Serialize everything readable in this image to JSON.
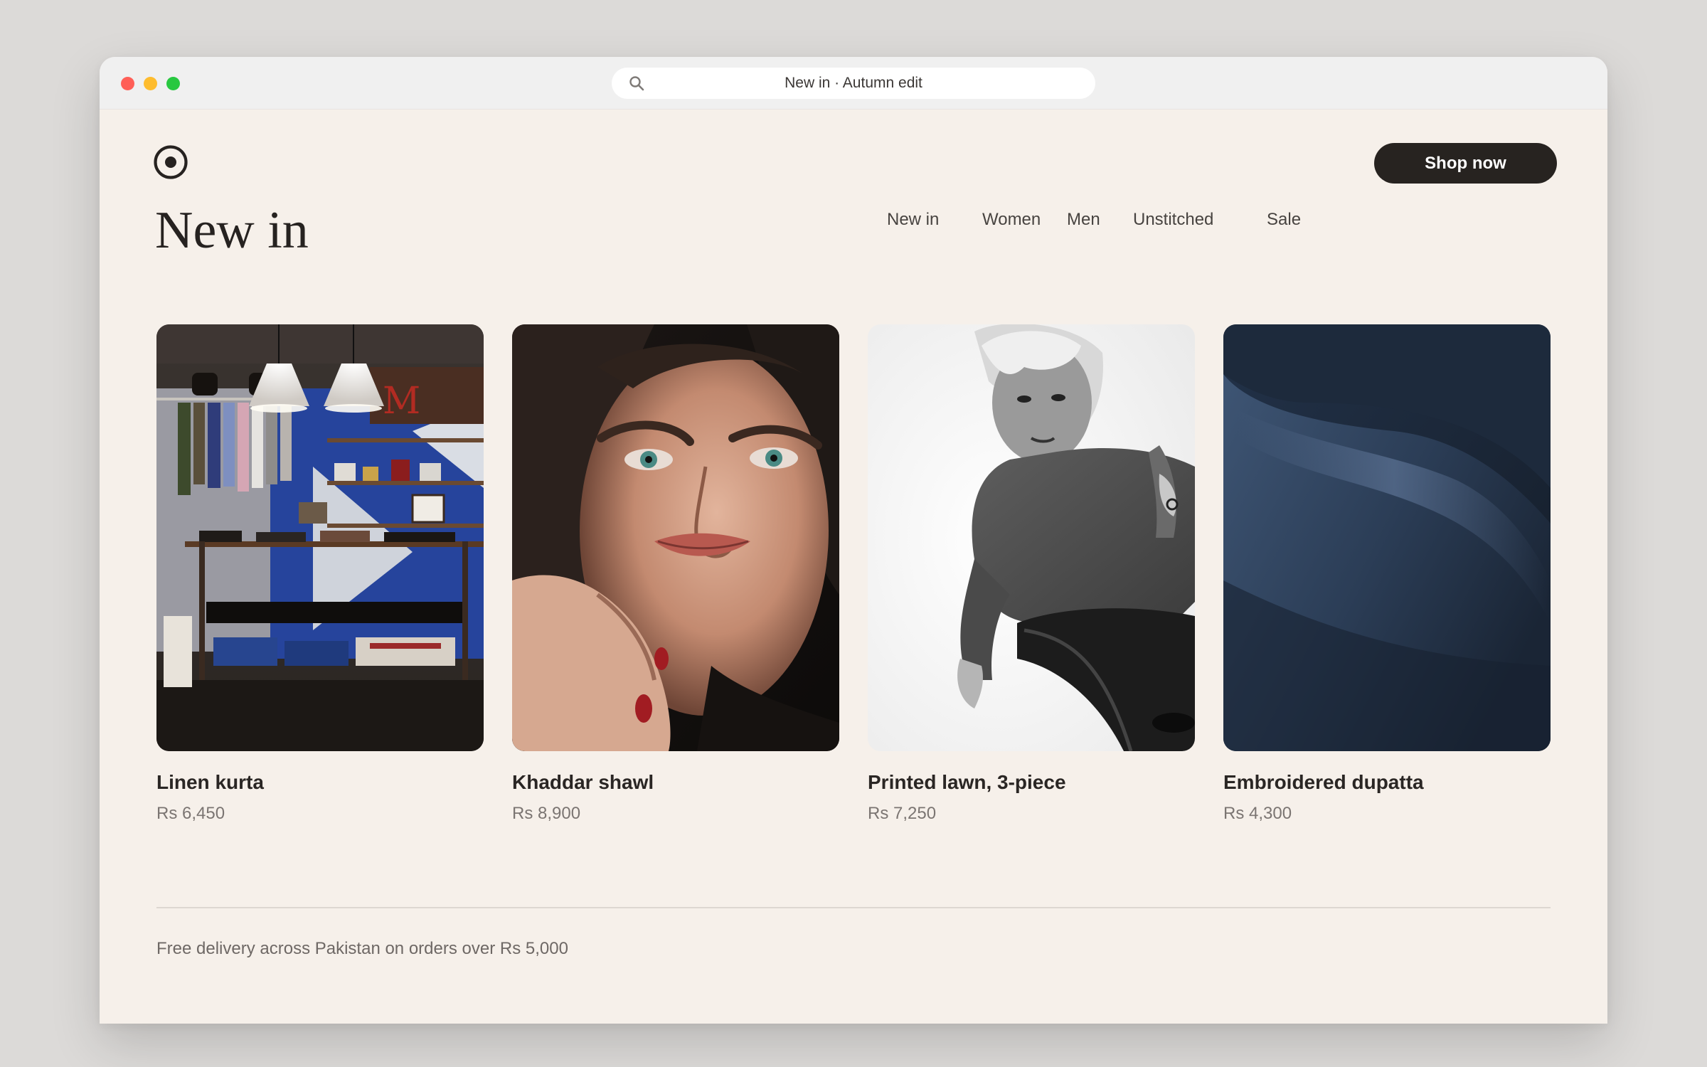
{
  "browser": {
    "url_text": "New in · Autumn edit"
  },
  "header": {
    "nav": [
      {
        "label": "New in"
      },
      {
        "label": "Women"
      },
      {
        "label": "Men"
      },
      {
        "label": "Unstitched"
      },
      {
        "label": "Sale"
      }
    ],
    "cta_label": "Shop now"
  },
  "main": {
    "title": "New in",
    "products": [
      {
        "name": "Linen kurta",
        "price": "Rs 6,450"
      },
      {
        "name": "Khaddar shawl",
        "price": "Rs 8,900"
      },
      {
        "name": "Printed lawn, 3-piece",
        "price": "Rs 7,250"
      },
      {
        "name": "Embroidered dupatta",
        "price": "Rs 4,300"
      }
    ]
  },
  "footer": {
    "note": "Free delivery across Pakistan on orders over Rs 5,000"
  },
  "colors": {
    "page_background": "#f6f0ea",
    "accent_button": "#272320",
    "text_primary": "#262220",
    "text_muted": "#7b7572"
  },
  "icons": {
    "search": "search-icon",
    "logo": "logo-icon"
  }
}
